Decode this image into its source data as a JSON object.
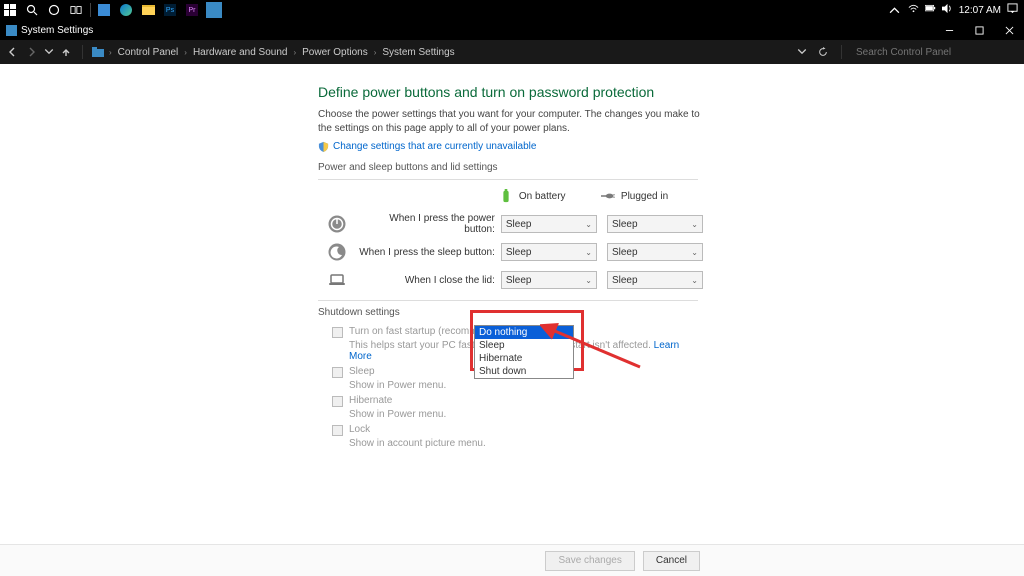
{
  "taskbar": {
    "clock": "12:07 AM"
  },
  "titlebar": {
    "title": "System Settings"
  },
  "addressbar": {
    "crumbs": [
      "Control Panel",
      "Hardware and Sound",
      "Power Options",
      "System Settings"
    ],
    "search_placeholder": "Search Control Panel"
  },
  "page": {
    "heading": "Define power buttons and turn on password protection",
    "description": "Choose the power settings that you want for your computer. The changes you make to the settings on this page apply to all of your power plans.",
    "change_link": "Change settings that are currently unavailable",
    "section_buttons": "Power and sleep buttons and lid settings",
    "col_battery": "On battery",
    "col_plugged": "Plugged in",
    "rows": [
      {
        "label": "When I press the power button:",
        "battery": "Sleep",
        "plugged": "Sleep"
      },
      {
        "label": "When I press the sleep button:",
        "battery": "Sleep",
        "plugged": "Sleep"
      },
      {
        "label": "When I close the lid:",
        "battery": "Sleep",
        "plugged": "Sleep"
      }
    ],
    "dropdown_options": [
      "Do nothing",
      "Sleep",
      "Hibernate",
      "Shut down"
    ],
    "dropdown_selected": "Do nothing",
    "section_shutdown": "Shutdown settings",
    "fast_startup_label": "Turn on fast startup (recommended)",
    "fast_startup_desc": "This helps start your PC faster after shutdown. Restart isn't affected. ",
    "learn_more": "Learn More",
    "sleep_label": "Sleep",
    "sleep_desc": "Show in Power menu.",
    "hibernate_label": "Hibernate",
    "hibernate_desc": "Show in Power menu.",
    "lock_label": "Lock",
    "lock_desc": "Show in account picture menu."
  },
  "buttons": {
    "save": "Save changes",
    "cancel": "Cancel"
  }
}
